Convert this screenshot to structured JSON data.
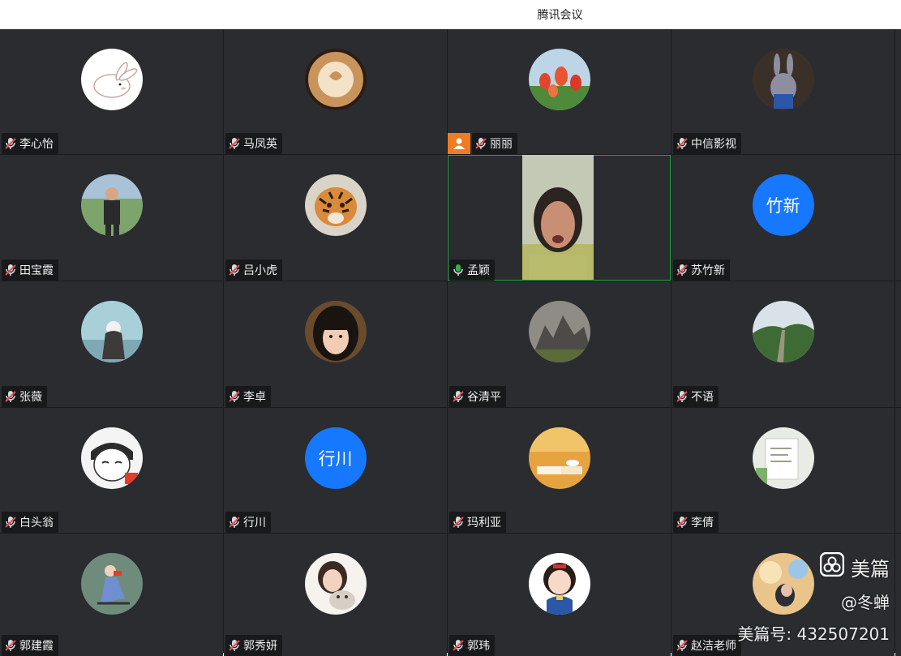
{
  "window": {
    "title": "腾讯会议"
  },
  "participants": [
    {
      "name": "李心怡",
      "avatar": "rabbit-cartoon-avatar",
      "mic": "muted"
    },
    {
      "name": "马凤英",
      "avatar": "latte-art-avatar",
      "mic": "muted"
    },
    {
      "name": "丽丽",
      "avatar": "tulips-avatar",
      "mic": "muted",
      "host": true
    },
    {
      "name": "中信影视",
      "avatar": "zootopia-judy-avatar",
      "mic": "muted"
    },
    {
      "name": "田宝霞",
      "avatar": "woman-outdoor-photo-avatar",
      "mic": "muted"
    },
    {
      "name": "吕小虎",
      "avatar": "tiger-avatar",
      "mic": "muted"
    },
    {
      "name": "孟颖",
      "avatar": "live-video-feed",
      "mic": "speaking",
      "video": true
    },
    {
      "name": "苏竹新",
      "avatar_text": "竹新",
      "mic": "muted"
    },
    {
      "name": "张薇",
      "avatar": "girl-with-sky-avatar",
      "mic": "muted"
    },
    {
      "name": "李卓",
      "avatar": "girl-portrait-avatar",
      "mic": "muted"
    },
    {
      "name": "谷清平",
      "avatar": "rock-garden-avatar",
      "mic": "muted"
    },
    {
      "name": "不语",
      "avatar": "great-wall-avatar",
      "mic": "muted"
    },
    {
      "name": "白头翁",
      "avatar": "cartoon-face-flag-avatar",
      "mic": "muted"
    },
    {
      "name": "行川",
      "avatar_text": "行川",
      "mic": "muted"
    },
    {
      "name": "玛利亚",
      "avatar": "book-and-coffee-avatar",
      "mic": "muted"
    },
    {
      "name": "李倩",
      "avatar": "writing-desk-avatar",
      "mic": "muted"
    },
    {
      "name": "郭建霞",
      "avatar": "fashion-illustration-avatar",
      "mic": "muted"
    },
    {
      "name": "郭秀妍",
      "avatar": "girl-with-cat-avatar",
      "mic": "muted"
    },
    {
      "name": "郭玮",
      "avatar": "snow-white-avatar",
      "mic": "muted"
    },
    {
      "name": "赵洁老师",
      "avatar": "girl-clouds-avatar",
      "mic": "muted"
    }
  ],
  "watermark": {
    "brand": "美篇",
    "handle": "@冬蝉",
    "id_text": "美篇号: 432507201"
  },
  "colors": {
    "tile_bg": "#2a2c30",
    "muted_mic": "#e34d59",
    "speaking_mic": "#2fb44a",
    "host_badge": "#f07b20",
    "initials_avatar": "#1677ff",
    "active_border": "#27a642"
  }
}
